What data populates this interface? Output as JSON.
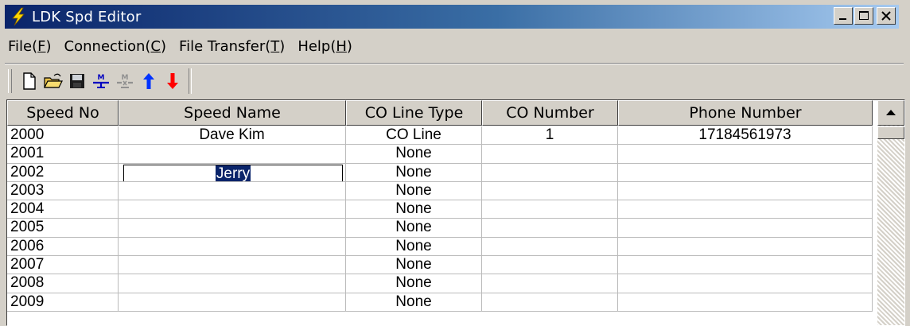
{
  "window": {
    "title": "LDK Spd Editor"
  },
  "menu": [
    {
      "pre": "File(",
      "key": "F",
      "post": ")"
    },
    {
      "pre": "Connection(",
      "key": "C",
      "post": ")"
    },
    {
      "pre": "File Transfer(",
      "key": "T",
      "post": ")"
    },
    {
      "pre": "Help(",
      "key": "H",
      "post": ")"
    }
  ],
  "toolbar": [
    "new-icon",
    "open-icon",
    "save-icon",
    "connect-icon",
    "disconnect-icon",
    "upload-icon",
    "download-icon"
  ],
  "columns": [
    "Speed No",
    "Speed Name",
    "CO Line Type",
    "CO Number",
    "Phone Number"
  ],
  "rows": [
    {
      "no": "2000",
      "name": "Dave Kim",
      "type": "CO Line",
      "co": "1",
      "phone": "17184561973"
    },
    {
      "no": "2001",
      "name": "",
      "type": "None",
      "co": "",
      "phone": ""
    },
    {
      "no": "2002",
      "name": "",
      "type": "None",
      "co": "",
      "phone": "",
      "edit": "Jerry"
    },
    {
      "no": "2003",
      "name": "",
      "type": "None",
      "co": "",
      "phone": ""
    },
    {
      "no": "2004",
      "name": "",
      "type": "None",
      "co": "",
      "phone": ""
    },
    {
      "no": "2005",
      "name": "",
      "type": "None",
      "co": "",
      "phone": ""
    },
    {
      "no": "2006",
      "name": "",
      "type": "None",
      "co": "",
      "phone": ""
    },
    {
      "no": "2007",
      "name": "",
      "type": "None",
      "co": "",
      "phone": ""
    },
    {
      "no": "2008",
      "name": "",
      "type": "None",
      "co": "",
      "phone": ""
    },
    {
      "no": "2009",
      "name": "",
      "type": "None",
      "co": "",
      "phone": ""
    }
  ],
  "colors": {
    "title_start": "#0a246a",
    "title_end": "#a6caf0",
    "face": "#d4d0c8",
    "selection": "#0a246a"
  }
}
